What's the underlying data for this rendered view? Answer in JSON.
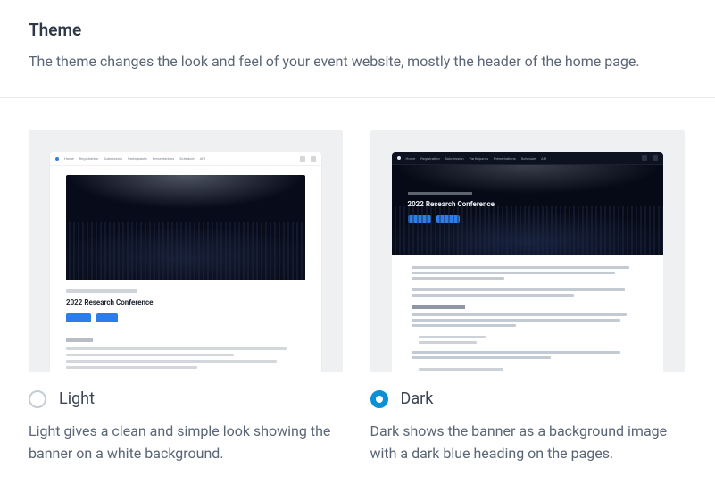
{
  "section": {
    "title": "Theme",
    "description": "The theme changes the look and feel of your event website, mostly the header of the home page."
  },
  "preview": {
    "conference_title": "2022 Research Conference"
  },
  "options": {
    "light": {
      "label": "Light",
      "description": "Light gives a clean and simple look showing the banner on a white background.",
      "selected": false
    },
    "dark": {
      "label": "Dark",
      "description": "Dark shows the banner as a background image with a dark blue heading on the pages.",
      "selected": true
    }
  }
}
